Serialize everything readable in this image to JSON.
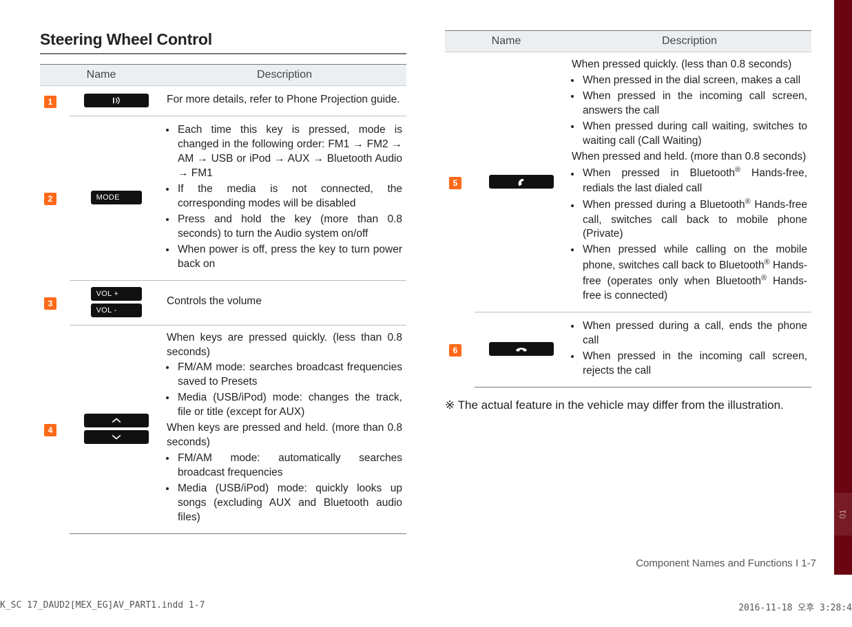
{
  "section_title": "Steering Wheel Control",
  "headers": {
    "name": "Name",
    "description": "Description"
  },
  "left_rows": [
    {
      "idx": "1",
      "pills": [
        {
          "kind": "voice"
        }
      ],
      "desc": {
        "bullets": [
          "For more details, refer to Phone Projection guide."
        ],
        "plain": true
      }
    },
    {
      "idx": "2",
      "pills": [
        {
          "text": "MODE"
        }
      ],
      "desc": {
        "bullets": [
          "Each time this key is pressed, mode is changed in the following order: FM1 → FM2 → AM → USB or iPod → AUX → Bluetooth Audio → FM1",
          "If the media is not connected, the corresponding modes will be disabled",
          "Press and hold the key (more than 0.8 seconds) to turn the Audio system on/off",
          "When power is off, press the key to turn power back on"
        ]
      }
    },
    {
      "idx": "3",
      "pills": [
        {
          "text": "VOL +"
        },
        {
          "text": "VOL -"
        }
      ],
      "desc": {
        "bullets": [
          "Controls the volume"
        ],
        "plain": true
      }
    },
    {
      "idx": "4",
      "pills": [
        {
          "kind": "up"
        },
        {
          "kind": "down"
        }
      ],
      "desc": {
        "lead1": "When keys are pressed quickly. (less than 0.8 seconds)",
        "bullets1": [
          "FM/AM mode: searches broadcast frequencies saved to Presets",
          "Media (USB/iPod) mode: changes the track, file or title (except for AUX)"
        ],
        "lead2": "When keys are pressed and held. (more than 0.8 seconds)",
        "bullets2": [
          "FM/AM mode: automatically searches broadcast frequencies",
          "Media (USB/iPod) mode: quickly looks up songs (excluding AUX and Bluetooth audio files)"
        ]
      }
    }
  ],
  "right_rows": [
    {
      "idx": "5",
      "pills": [
        {
          "kind": "call"
        }
      ],
      "desc": {
        "lead1": "When pressed quickly. (less than 0.8 seconds)",
        "bullets1": [
          "When pressed in the dial screen, makes a call",
          "When pressed in the incoming call screen, answers the call",
          "When pressed during call waiting, switches to waiting call (Call Waiting)"
        ],
        "lead2": "When pressed and held. (more than 0.8 seconds)",
        "bullets2": [
          "When pressed in Bluetooth® Hands-free, redials the last dialed call",
          "When pressed during a Bluetooth® Hands-free call, switches call back to mobile phone (Private)",
          "When pressed while calling on the mobile phone, switches call back to Bluetooth® Hands-free (operates only when Bluetooth® Hands-free is connected)"
        ]
      }
    },
    {
      "idx": "6",
      "pills": [
        {
          "kind": "end"
        }
      ],
      "desc": {
        "bullets": [
          "When pressed during a call, ends the phone call",
          "When pressed in the incoming call screen, rejects the call"
        ]
      }
    }
  ],
  "note": "※ The actual feature in the vehicle may differ from the illustration.",
  "page_footer": "Component Names and Functions I 1-7",
  "tab_label": "01",
  "doc_footer_left": "K_SC 17_DAUD2[MEX_EG]AV_PART1.indd   1-7",
  "doc_footer_right": "2016-11-18   오후 3:28:4"
}
